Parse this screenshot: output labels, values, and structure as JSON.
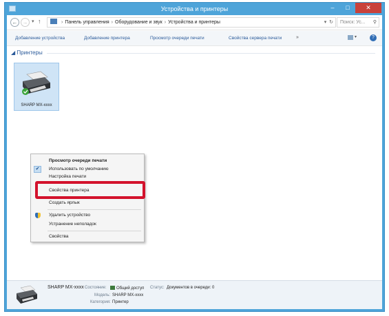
{
  "window": {
    "title": "Устройства и принтеры",
    "minimize_glyph": "–",
    "maximize_glyph": "□",
    "close_glyph": "✕"
  },
  "address": {
    "crumbs": [
      "Панель управления",
      "Оборудование и звук",
      "Устройства и принтеры"
    ],
    "search_placeholder": "Поиск: Ус..."
  },
  "commands": [
    "Добавление устройства",
    "Добавление принтера",
    "Просмотр очереди печати",
    "Свойства сервера печати"
  ],
  "group": {
    "label": "Принтеры"
  },
  "printer": {
    "name": "SHARP MX-xxxx"
  },
  "context_menu": {
    "items": [
      "Просмотр очереди печати",
      "Использовать по умолчанию",
      "Настройка печати",
      "Свойства принтера",
      "Создать ярлык",
      "Удалить устройство",
      "Устранение неполадок",
      "Свойства"
    ],
    "highlight_color": "#d3122c"
  },
  "details": {
    "name": "SHARP MX-xxxx",
    "state_label": "Состояние:",
    "state_value": "Общий доступ",
    "status_label": "Статус:",
    "status_value": "Документов в очереди: 0",
    "model_label": "Модель:",
    "model_value": "SHARP MX-xxxx",
    "category_label": "Категория:",
    "category_value": "Принтер"
  },
  "colors": {
    "titlebar": "#4ea4d9",
    "tile_selected": "#cfe4f6",
    "link": "#2a5a9a"
  }
}
